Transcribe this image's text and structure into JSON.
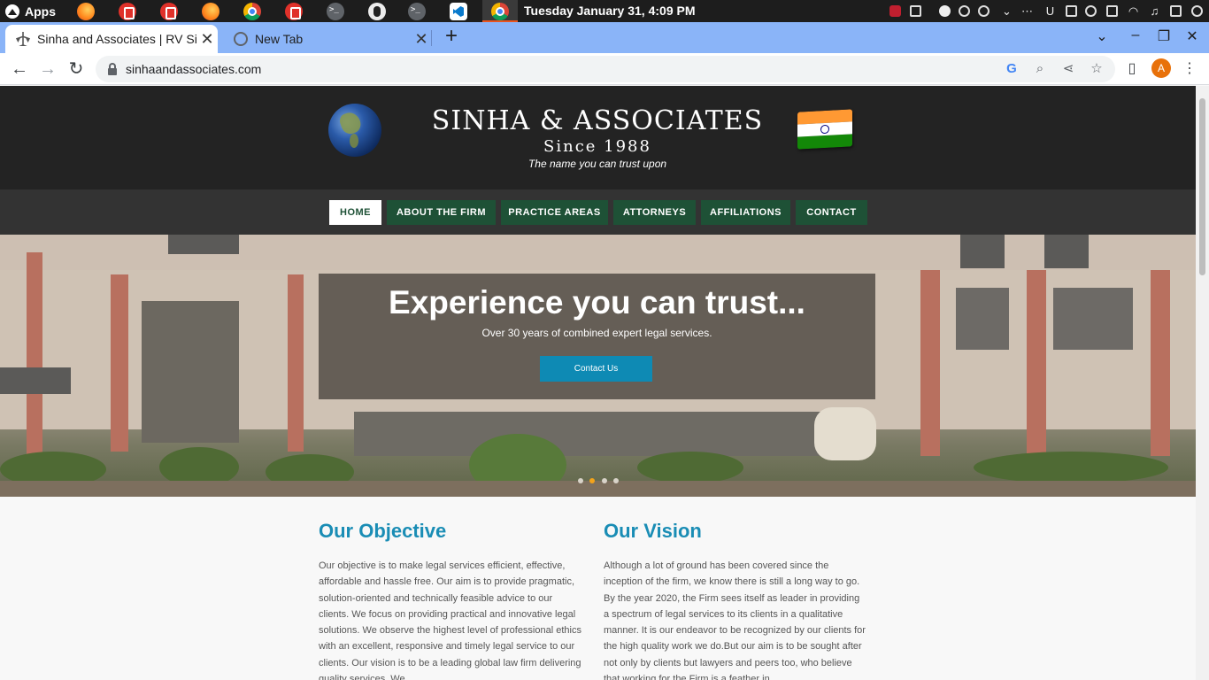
{
  "os": {
    "apps_label": "Apps",
    "clock": "Tuesday January 31, 4:09 PM",
    "taskbar_icons": [
      "firefox-icon",
      "pdf-icon",
      "pdf-icon",
      "firefox-icon",
      "chrome-icon",
      "pdf-icon",
      "terminal-icon",
      "linux-icon",
      "terminal-icon",
      "vscode-icon",
      "chrome-icon"
    ]
  },
  "browser": {
    "tabs": [
      {
        "title": "Sinha and Associates | RV Sinha",
        "close": "✕"
      },
      {
        "title": "New Tab",
        "close": "✕"
      }
    ],
    "new_tab": "+",
    "url": "sinhaandassociates.com",
    "profile_initial": "A",
    "accent": "#8ab4f8"
  },
  "site": {
    "brand": {
      "name": "SINHA & ASSOCIATES",
      "since": "Since 1988",
      "tagline": "The name you can trust upon"
    },
    "nav": [
      "HOME",
      "ABOUT THE FIRM",
      "PRACTICE AREAS",
      "ATTORNEYS",
      "AFFILIATIONS",
      "CONTACT"
    ],
    "active_nav": "HOME",
    "hero": {
      "title": "Experience you can trust...",
      "subtitle": "Over 30 years of combined expert legal services.",
      "button": "Contact Us",
      "slides": 4,
      "active_slide": 2
    },
    "objective": {
      "title": "Our Objective",
      "body": "Our objective is to make legal services efficient, effective, affordable and hassle free. Our aim is to provide pragmatic, solution-oriented and technically feasible advice to our clients. We focus on providing practical and innovative legal solutions. We observe the highest level of professional ethics with an excellent, responsive and timely legal service to our clients. Our vision is to be a leading global law firm delivering quality services. We"
    },
    "vision": {
      "title": "Our Vision",
      "body": "Although a lot of ground has been covered since the inception of the firm, we know there is still a long way to go. By the year 2020, the Firm sees itself as leader in providing a spectrum of legal services to its clients in a qualitative manner. It is our endeavor to be recognized by our clients for the high quality work we do.But our aim is to be sought after not only by clients but lawyers and peers too, who believe that working for the Firm is a feather in"
    },
    "colors": {
      "header_bg": "#232323",
      "nav_bg": "#333333",
      "nav_button": "#1e5136",
      "accent_blue": "#1a8db5",
      "cta": "#0e8ab4"
    }
  }
}
